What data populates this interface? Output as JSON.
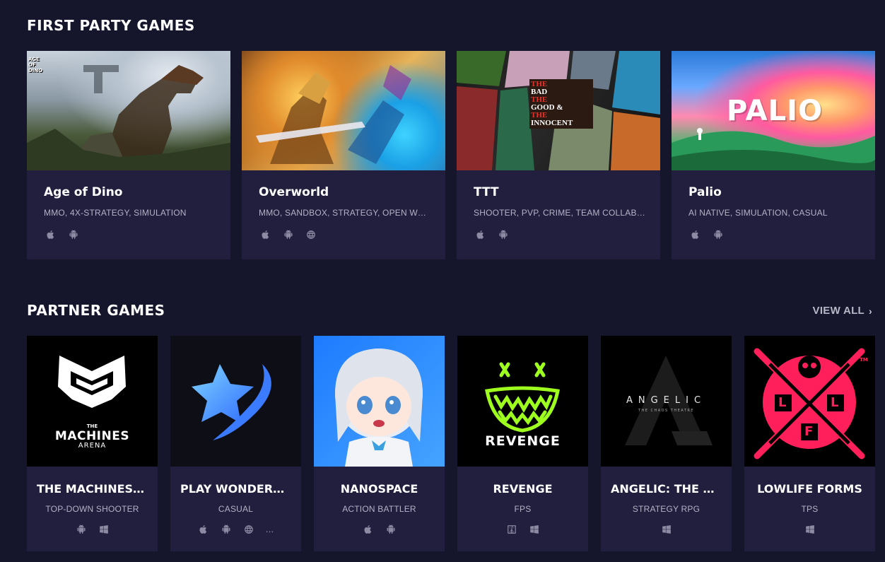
{
  "first_party": {
    "title": "FIRST PARTY GAMES",
    "games": [
      {
        "name": "Age of Dino",
        "genres": "MMO, 4X-STRATEGY, SIMULATION",
        "platforms": [
          "apple-icon",
          "android-icon"
        ],
        "art_logo": "AGE OF DINO"
      },
      {
        "name": "Overworld",
        "genres": "MMO, SANDBOX, STRATEGY, OPEN WORLD",
        "platforms": [
          "apple-icon",
          "android-icon",
          "globe-icon"
        ]
      },
      {
        "name": "TTT",
        "genres": "SHOOTER, PVP, CRIME, TEAM COLLABORATION",
        "platforms": [
          "apple-icon",
          "android-icon"
        ],
        "art_logo": [
          "THE",
          "BAD",
          "THE",
          "GOOD &",
          "THE",
          "INNOCENT"
        ]
      },
      {
        "name": "Palio",
        "genres": "AI NATIVE, SIMULATION, CASUAL",
        "platforms": [
          "apple-icon",
          "android-icon"
        ],
        "art_logo": "PALIO"
      }
    ]
  },
  "partner": {
    "title": "PARTNER GAMES",
    "view_all": "VIEW ALL",
    "games": [
      {
        "name": "THE MACHINES ARENA",
        "genre": "TOP-DOWN SHOOTER",
        "platforms": [
          "android-icon",
          "windows-icon"
        ],
        "logo_top": "THE",
        "logo_main": "MACHINES",
        "logo_sub": "ARENA"
      },
      {
        "name": "PLAY WONDERLAND",
        "genre": "CASUAL",
        "platforms": [
          "apple-icon",
          "android-icon",
          "globe-icon"
        ],
        "more": "..."
      },
      {
        "name": "NANOSPACE",
        "genre": "ACTION BATTLER",
        "platforms": [
          "apple-icon",
          "android-icon"
        ]
      },
      {
        "name": "REVENGE",
        "genre": "FPS",
        "platforms": [
          "finder-icon",
          "windows-icon"
        ],
        "logo_main": "REVENGE"
      },
      {
        "name": "ANGELIC: THE CHAOS THEATRE",
        "genre": "STRATEGY RPG",
        "platforms": [
          "windows-icon"
        ],
        "logo_main": "ANGELIC",
        "logo_sub": "THE CHAOS THEATRE"
      },
      {
        "name": "LOWLIFE FORMS",
        "genre": "TPS",
        "platforms": [
          "windows-icon"
        ],
        "logo_letters": [
          "L",
          "L",
          "F"
        ],
        "logo_tm": "TM"
      }
    ]
  },
  "colors": {
    "background": "#15152b",
    "card": "#211f3d",
    "muted_text": "#b3b2c6",
    "icon": "#8d8ba3",
    "revenge_green": "#9eff1e",
    "lowlife_pink": "#ff1f5a"
  }
}
